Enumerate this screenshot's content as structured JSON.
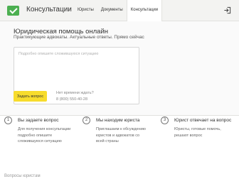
{
  "header": {
    "brand": "Консультации",
    "nav": [
      "Юристы",
      "Документы",
      "Консультации"
    ],
    "active_nav": 2,
    "login_icon": "login-icon"
  },
  "main": {
    "title": "Юридическая помощь онлайн",
    "subtitle": "Практикующие адвокаты. Актуальные ответы. Прямо сейчас",
    "question_placeholder": "Подробно опишите сложившуюся ситуацию",
    "ask_button": "Задать вопрос",
    "wait_text": "Нет времени ждать?",
    "phone": "8 (800) 550-40-28"
  },
  "steps": [
    {
      "num": "1",
      "title": "Вы задаете вопрос",
      "desc": "Для получения консультации\nподробно опишите\nсложившуюся ситуацию"
    },
    {
      "num": "2",
      "title": "Мы находим юриста",
      "desc": "Приглашаем к обсуждению\nюристов и адвокатов со\nвсей страны"
    },
    {
      "num": "3",
      "title": "Юрист отвечает на вопрос",
      "desc": "Юристы, готовые помочь,\nрешают вопрос"
    }
  ],
  "footer_partial": "Вопросы юристам"
}
